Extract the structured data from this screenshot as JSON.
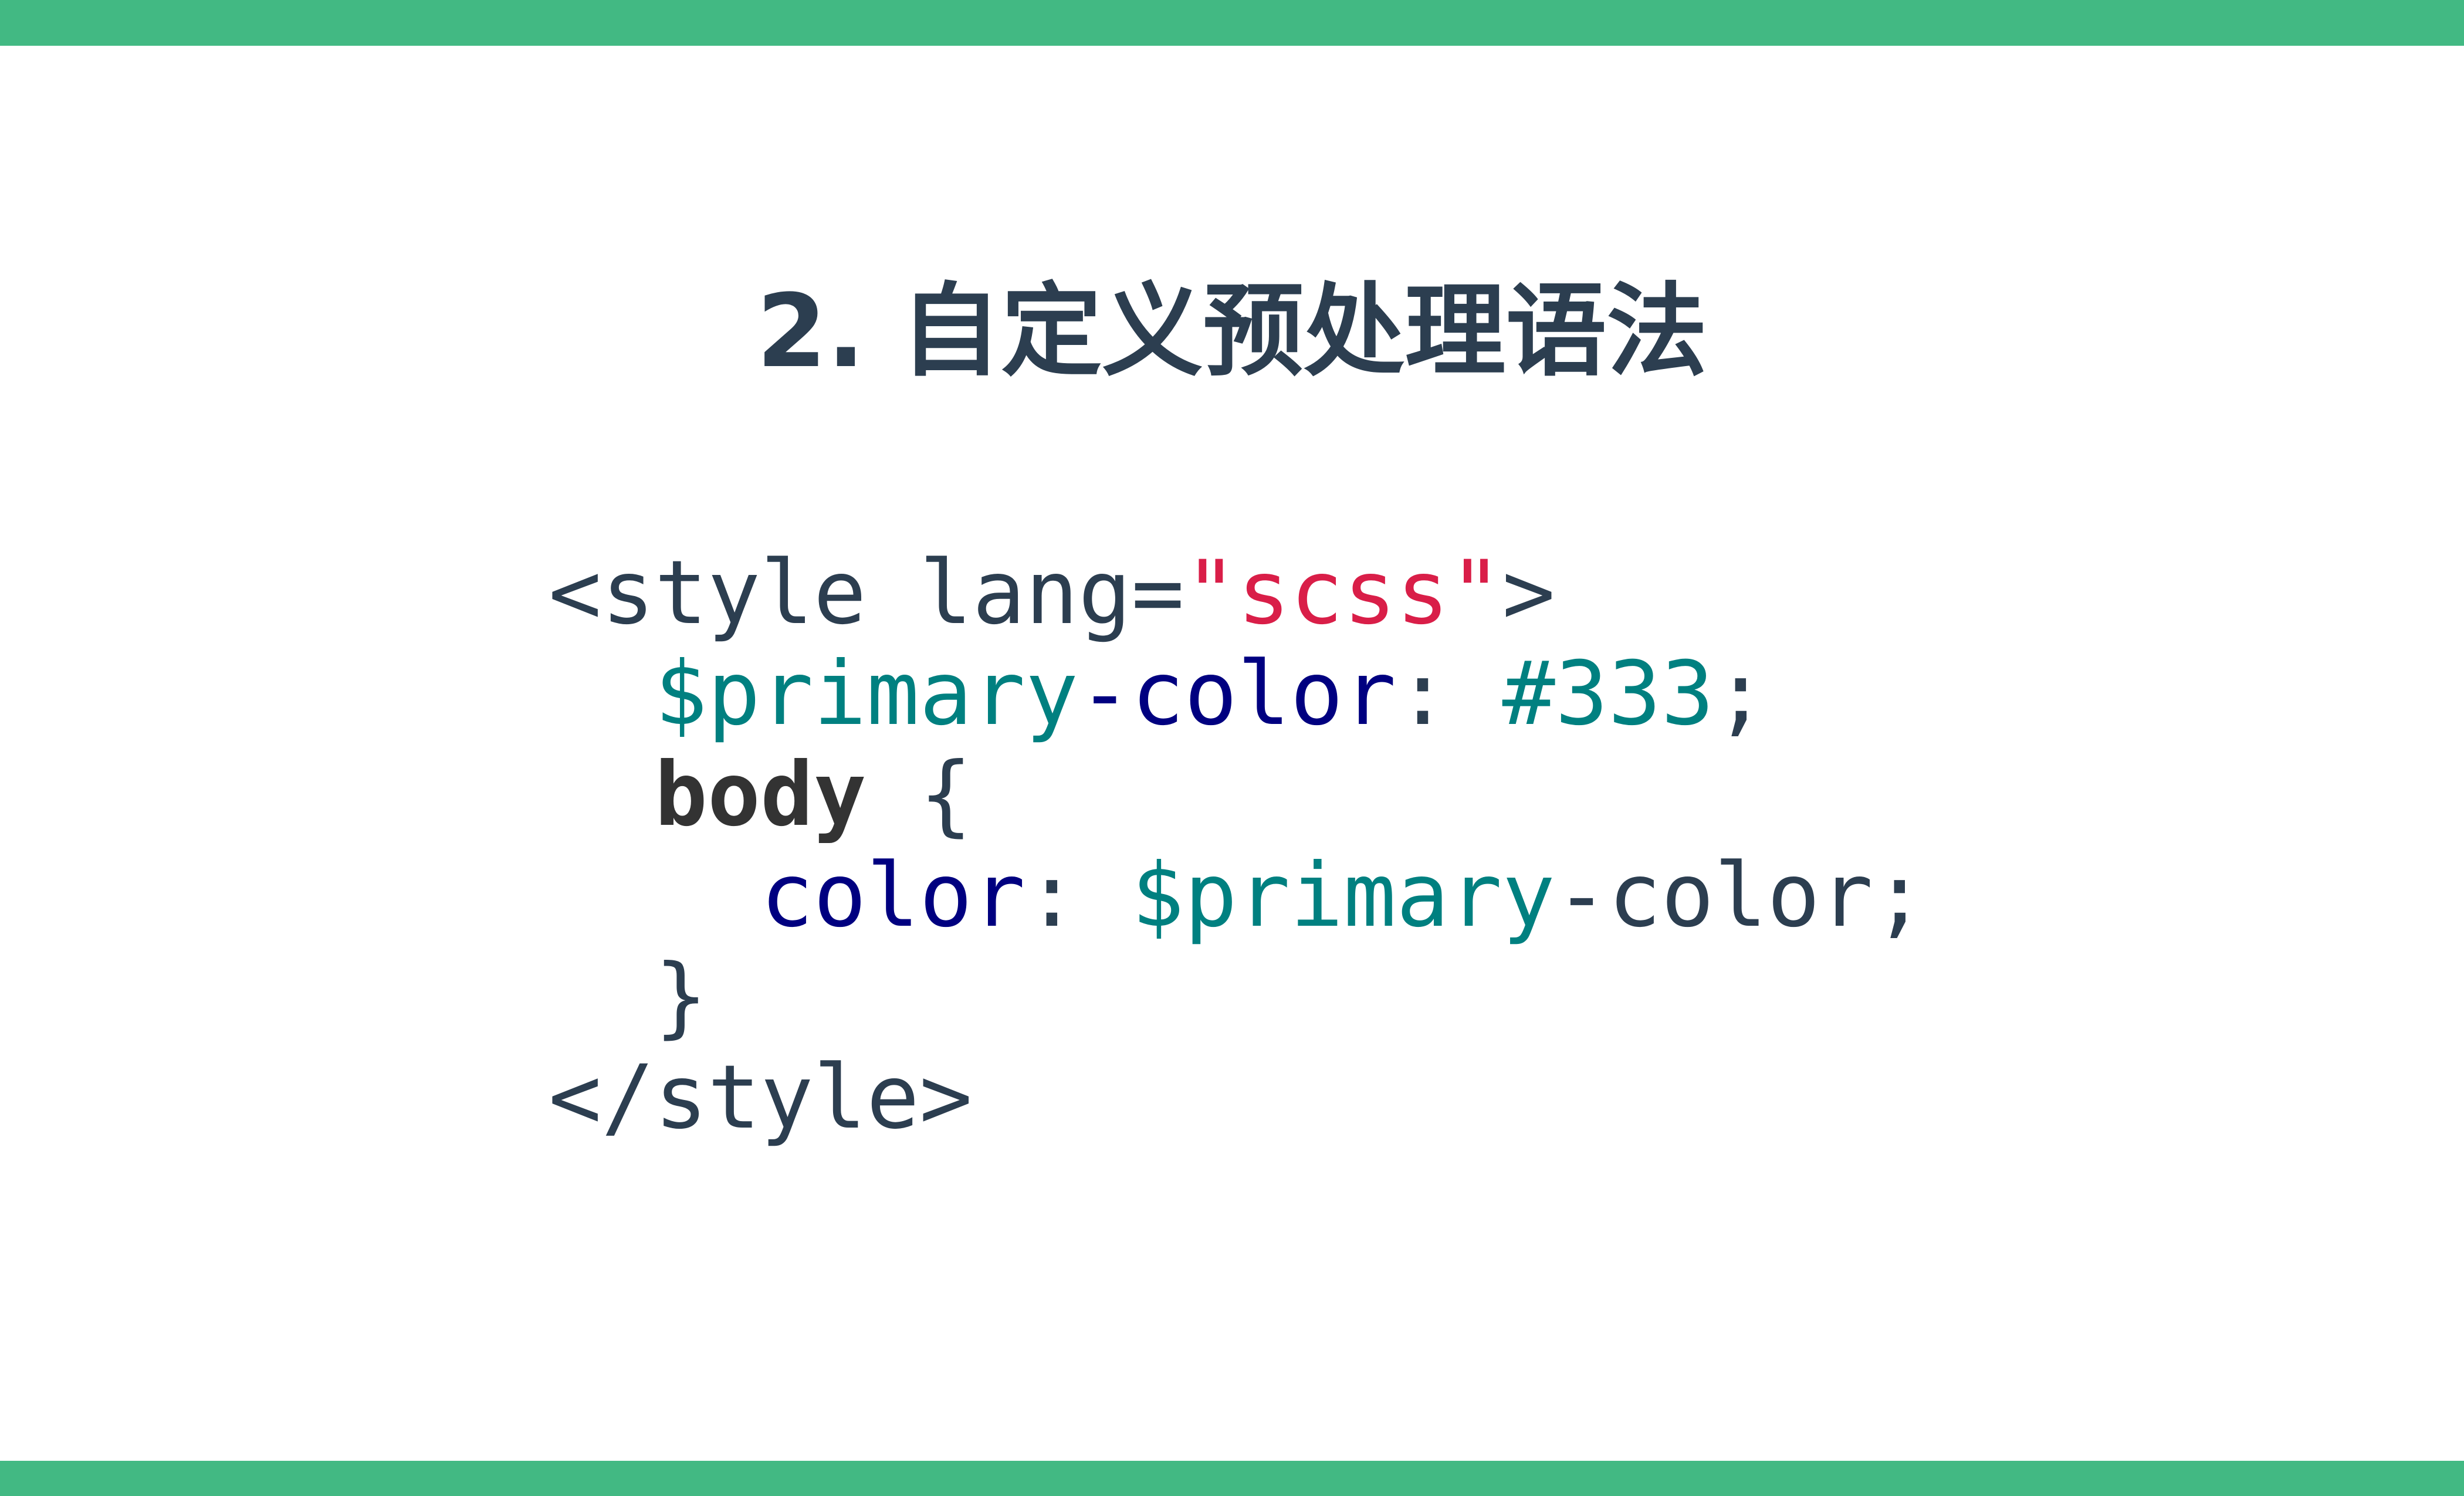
{
  "slide": {
    "title": "2. 自定义预处理语法"
  },
  "code": {
    "line1": {
      "open_tag": "<style lang=",
      "attr_value": "\"scss\"",
      "close": ">"
    },
    "line2": {
      "indent": "  ",
      "variable": "$primary",
      "property": "-color",
      "colon": ":",
      "space": " ",
      "value": "#333",
      "end": ";"
    },
    "line3": {
      "indent": "  ",
      "selector": "body",
      "brace": " {"
    },
    "line4": {
      "indent": "    ",
      "property": "color",
      "colon": ":",
      "space": " ",
      "variable": "$primary",
      "rest": "-color;"
    },
    "line5": {
      "text": "  }"
    },
    "line6": {
      "text": "</style>"
    }
  },
  "colors": {
    "accent_bar": "#42b983",
    "title": "#2c3e50",
    "string": "#d91e48",
    "variable": "#008080",
    "property": "#000080",
    "selector": "#333333"
  }
}
